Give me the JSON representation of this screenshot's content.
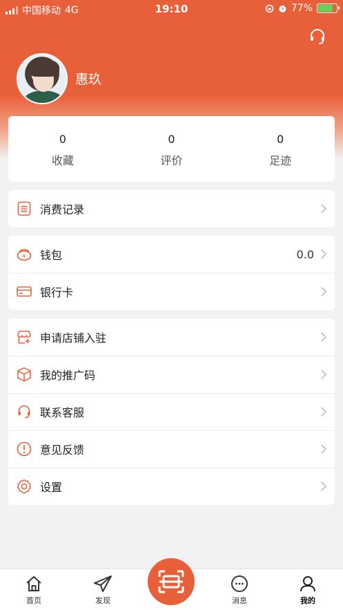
{
  "status_bar": {
    "carrier": "中国移动",
    "network": "4G",
    "time": "19:10",
    "battery": "77%"
  },
  "profile": {
    "username": "惠玖"
  },
  "stats": [
    {
      "value": "0",
      "label": "收藏"
    },
    {
      "value": "0",
      "label": "评价"
    },
    {
      "value": "0",
      "label": "足迹"
    }
  ],
  "menu": {
    "records": {
      "label": "消费记录"
    },
    "wallet": {
      "label": "钱包",
      "value": "0.0"
    },
    "bank_card": {
      "label": "银行卡"
    },
    "apply_store": {
      "label": "申请店铺入驻"
    },
    "promo_code": {
      "label": "我的推广码"
    },
    "contact_service": {
      "label": "联系客服"
    },
    "feedback": {
      "label": "意见反馈"
    },
    "settings": {
      "label": "设置"
    }
  },
  "tabbar": {
    "home": "首页",
    "discover": "发现",
    "messages": "消息",
    "mine": "我的"
  },
  "colors": {
    "accent": "#e8603a",
    "background": "#f2f2f2"
  }
}
